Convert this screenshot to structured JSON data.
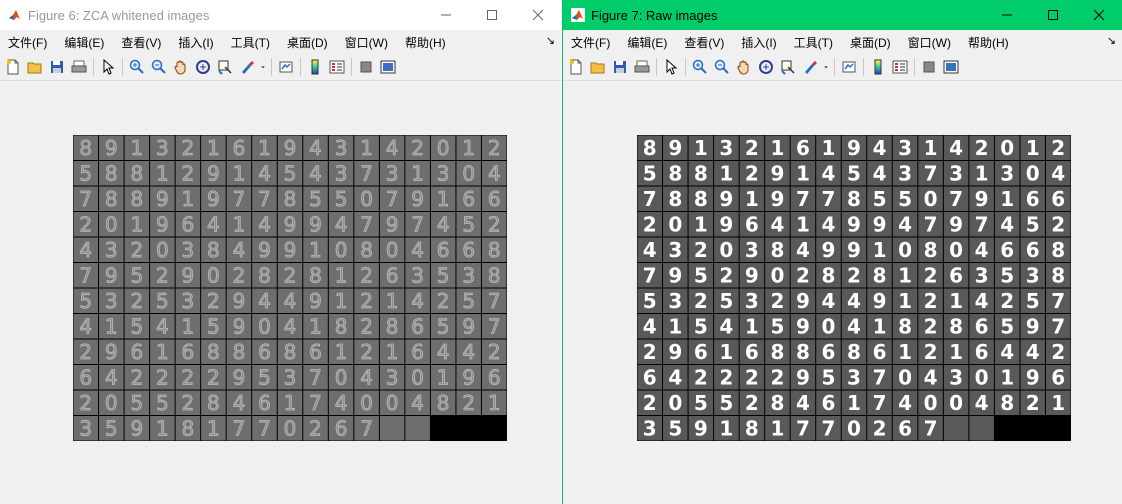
{
  "windows": [
    {
      "title": "Figure 6: ZCA whitened images",
      "active": false,
      "variant": "zca",
      "menu": [
        "文件(F)",
        "编辑(E)",
        "查看(V)",
        "插入(I)",
        "工具(T)",
        "桌面(D)",
        "窗口(W)",
        "帮助(H)"
      ]
    },
    {
      "title": "Figure 7: Raw images",
      "active": true,
      "variant": "raw",
      "menu": [
        "文件(F)",
        "编辑(E)",
        "查看(V)",
        "插入(I)",
        "工具(T)",
        "桌面(D)",
        "窗口(W)",
        "帮助(H)"
      ]
    }
  ],
  "grid": {
    "rows": 12,
    "cols": 17,
    "filled": 201,
    "digits": [
      "89132161943142012",
      "58812914543731304",
      "78891977855079166",
      "20196414994797452",
      "43203849910804668",
      "79529028281263538",
      "53253294491214257",
      "41541590418286597",
      "29616886861216442",
      "64222295370430196",
      "20552846174004821",
      "359181770267"
    ]
  },
  "colors": {
    "active_title": "#00cc6a",
    "inactive_title": "#ffffff",
    "window_bg": "#f0f0f0",
    "tile_bg_raw": "#595959",
    "tile_bg_zca": "#6e6e6e",
    "empty_cell": "#000000"
  },
  "icons": [
    "new-file-icon",
    "open-folder-icon",
    "save-icon",
    "print-icon",
    "pointer-icon",
    "zoom-in-icon",
    "zoom-out-icon",
    "pan-hand-icon",
    "rotate-3d-icon",
    "data-cursor-icon",
    "brush-icon",
    "dropdown-arrow-icon",
    "link-plot-icon",
    "colorbar-icon",
    "legend-icon",
    "hide-plot-tools-icon",
    "show-plot-tools-icon"
  ]
}
